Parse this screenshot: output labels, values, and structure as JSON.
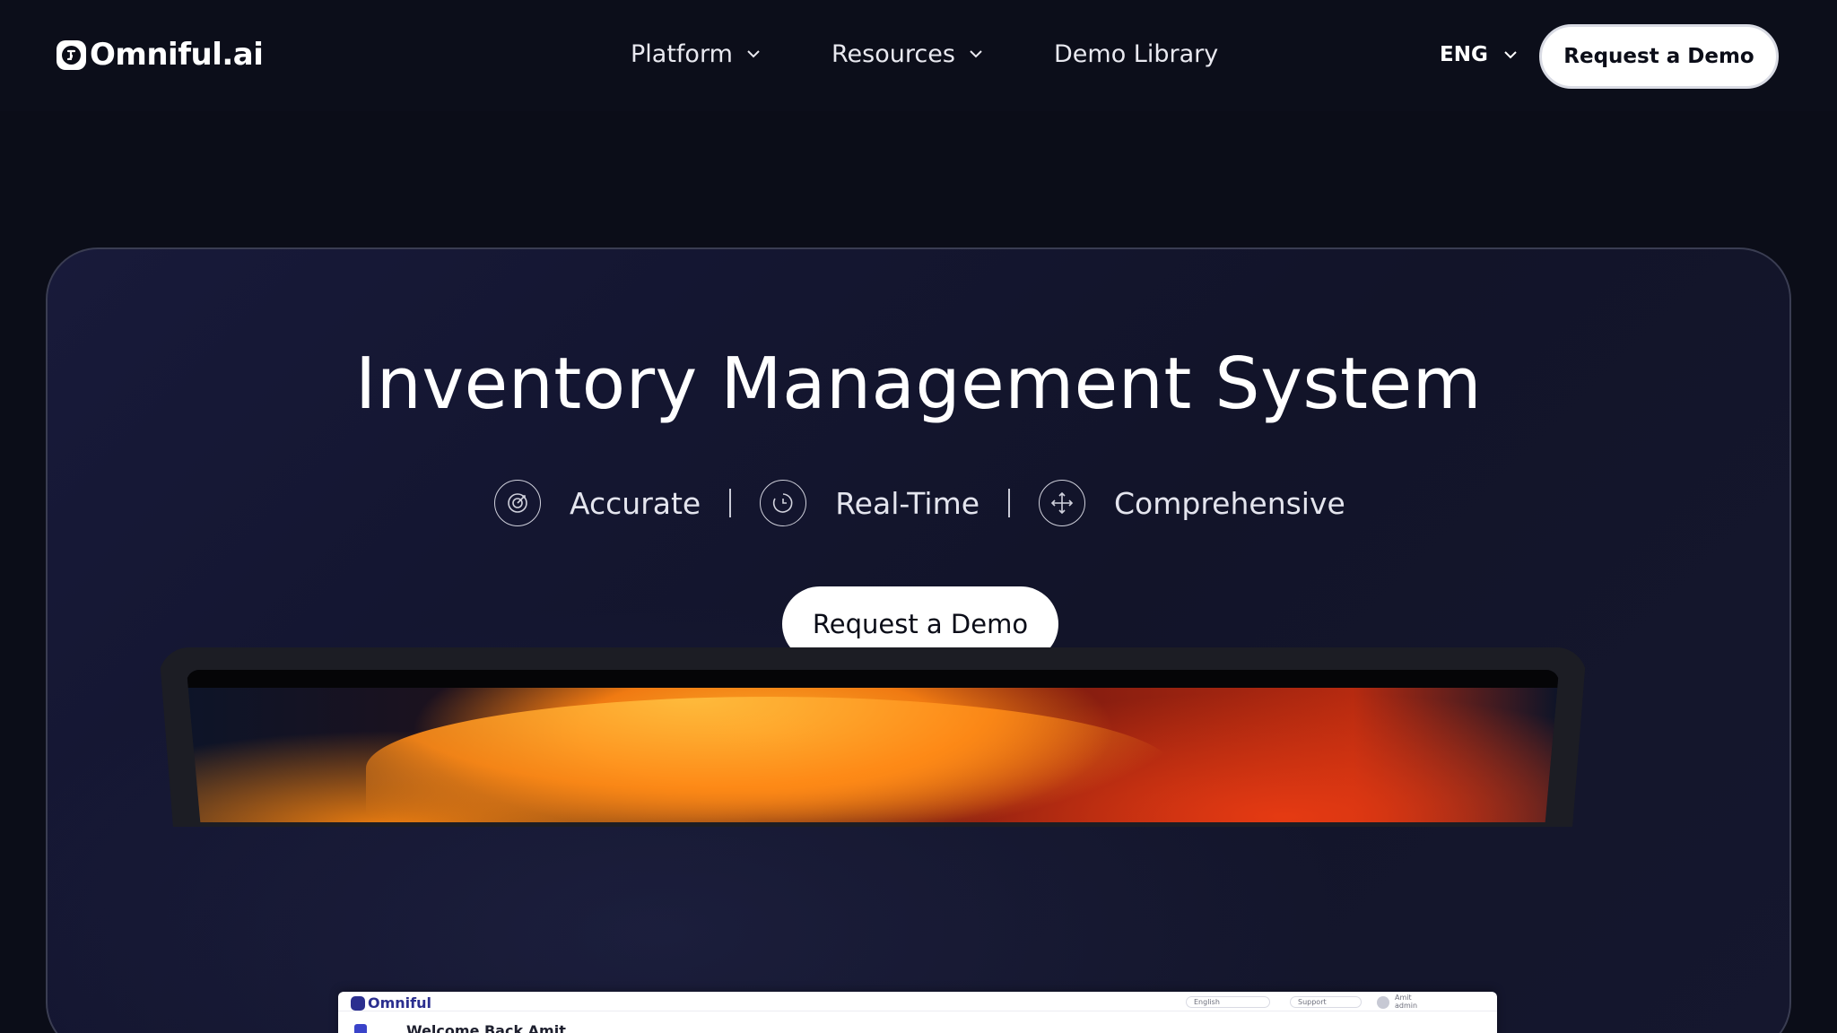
{
  "brand": {
    "name": "Omniful.ai"
  },
  "nav": {
    "platform": "Platform",
    "resources": "Resources",
    "demo_library": "Demo Library",
    "language": "ENG",
    "request_demo": "Request a Demo"
  },
  "hero": {
    "title": "Inventory Management System",
    "features": [
      {
        "label": "Accurate",
        "icon": "target-icon"
      },
      {
        "label": "Real-Time",
        "icon": "clock-icon"
      },
      {
        "label": "Comprehensive",
        "icon": "move-arrows-icon"
      }
    ],
    "cta": "Request a Demo"
  },
  "mockup": {
    "app_name": "Omniful",
    "language": "English",
    "support": "Support",
    "user_name": "Amit",
    "user_role": "admin",
    "welcome": "Welcome Back Amit"
  },
  "colors": {
    "background": "#0b0d18",
    "card": "#141631",
    "button": "#ffffff",
    "button_text": "#0b0d18"
  }
}
